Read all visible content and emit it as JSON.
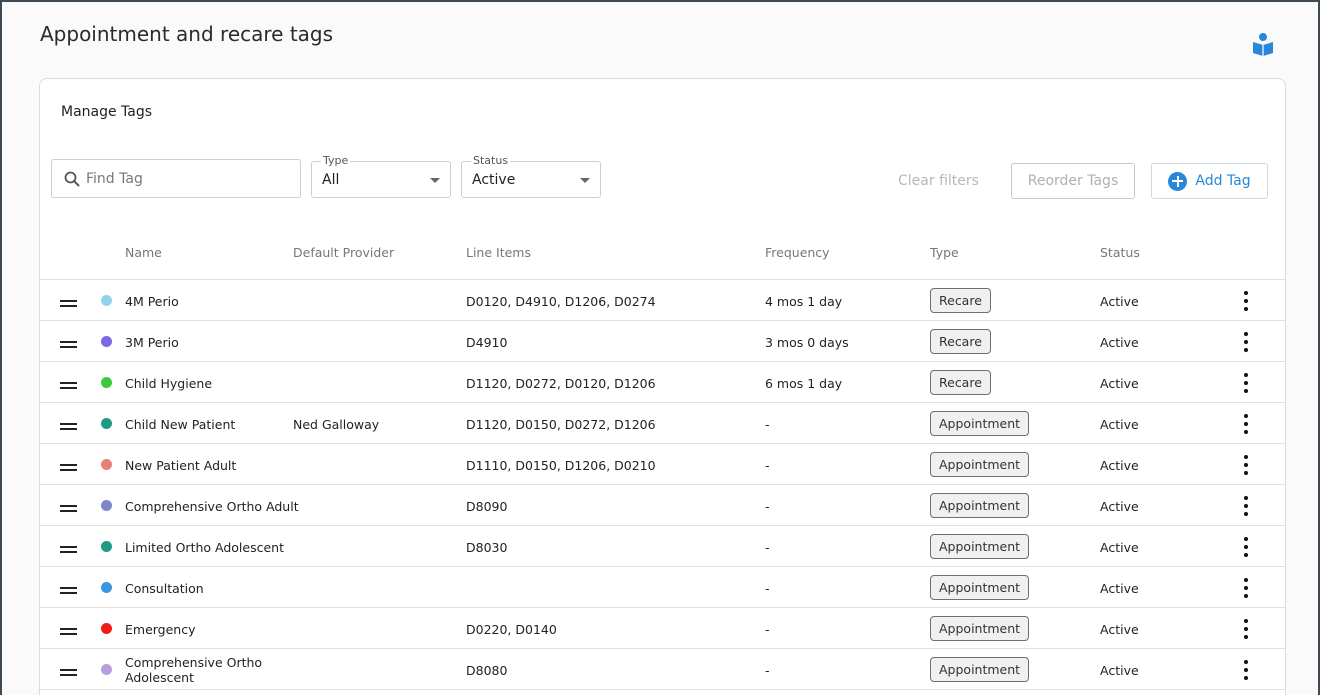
{
  "page": {
    "title": "Appointment and recare tags",
    "help_icon": "book-reader-icon"
  },
  "card": {
    "title": "Manage Tags"
  },
  "filters": {
    "search_placeholder": "Find Tag",
    "search_value": "",
    "type_label": "Type",
    "type_value": "All",
    "status_label": "Status",
    "status_value": "Active",
    "clear_label": "Clear filters",
    "reorder_label": "Reorder Tags",
    "add_label": "Add Tag"
  },
  "table": {
    "headers": {
      "name": "Name",
      "provider": "Default Provider",
      "line_items": "Line Items",
      "frequency": "Frequency",
      "type": "Type",
      "status": "Status"
    },
    "rows": [
      {
        "color": "#8fd3ec",
        "name": "4M Perio",
        "provider": "",
        "line_items": "D0120, D4910, D1206, D0274",
        "frequency": "4 mos 1 day",
        "type": "Recare",
        "status": "Active"
      },
      {
        "color": "#7b68e6",
        "name": "3M Perio",
        "provider": "",
        "line_items": "D4910",
        "frequency": "3 mos 0 days",
        "type": "Recare",
        "status": "Active"
      },
      {
        "color": "#3cc83c",
        "name": "Child Hygiene",
        "provider": "",
        "line_items": "D1120, D0272, D0120, D1206",
        "frequency": "6 mos 1 day",
        "type": "Recare",
        "status": "Active"
      },
      {
        "color": "#1f9a84",
        "name": "Child New Patient",
        "provider": "Ned Galloway",
        "line_items": "D1120, D0150, D0272, D1206",
        "frequency": "-",
        "type": "Appointment",
        "status": "Active"
      },
      {
        "color": "#e88078",
        "name": "New Patient Adult",
        "provider": "",
        "line_items": "D1110, D0150, D1206, D0210",
        "frequency": "-",
        "type": "Appointment",
        "status": "Active"
      },
      {
        "color": "#7e86c6",
        "name": "Comprehensive Ortho Adult",
        "provider": "",
        "line_items": "D8090",
        "frequency": "-",
        "type": "Appointment",
        "status": "Active"
      },
      {
        "color": "#1f9a84",
        "name": "Limited Ortho Adolescent",
        "provider": "",
        "line_items": "D8030",
        "frequency": "-",
        "type": "Appointment",
        "status": "Active"
      },
      {
        "color": "#3a96e0",
        "name": "Consultation",
        "provider": "",
        "line_items": "",
        "frequency": "-",
        "type": "Appointment",
        "status": "Active"
      },
      {
        "color": "#ee1c1c",
        "name": "Emergency",
        "provider": "",
        "line_items": "D0220, D0140",
        "frequency": "-",
        "type": "Appointment",
        "status": "Active"
      },
      {
        "color": "#b89ee0",
        "name": "Comprehensive Ortho Adolescent",
        "name_line1": "Comprehensive Ortho",
        "name_line2": "Adolescent",
        "provider": "",
        "line_items": "D8080",
        "frequency": "-",
        "type": "Appointment",
        "status": "Active"
      }
    ]
  }
}
